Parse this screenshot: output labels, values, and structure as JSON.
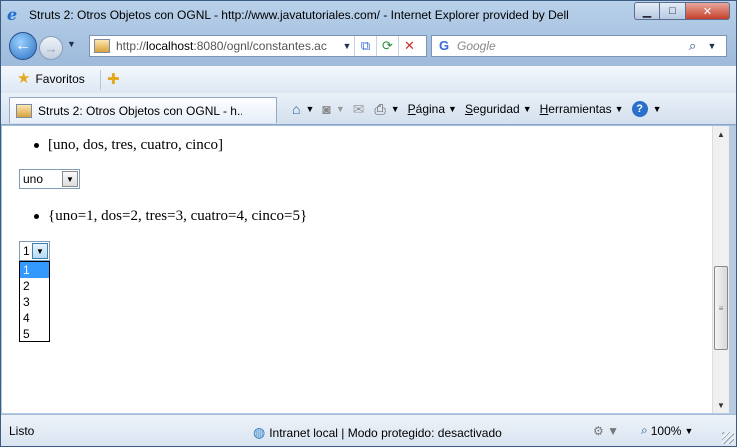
{
  "window": {
    "title": "Struts 2: Otros Objetos con OGNL - http://www.javatutoriales.com/ - Internet Explorer provided by Dell",
    "minimize": "▁",
    "maximize": "□",
    "close": "✕"
  },
  "nav": {
    "url_host": "http://",
    "url_bold": "localhost",
    "url_rest": ":8080/ognl/constantes.ac",
    "search_placeholder": "Google"
  },
  "favorites": {
    "label": "Favoritos"
  },
  "tab": {
    "label": "Struts 2: Otros Objetos con OGNL - h..."
  },
  "commandbar": {
    "page": "Página",
    "page_underline": "P",
    "page_rest": "ágina",
    "safety_underline": "S",
    "safety_rest": "eguridad",
    "tools_underline": "H",
    "tools_rest": "erramientas"
  },
  "content": {
    "list1": "[uno, dos, tres, cuatro, cinco]",
    "select1_value": "uno",
    "list2": "{uno=1, dos=2, tres=3, cuatro=4, cinco=5}",
    "select2_value": "1",
    "select2_options": [
      "1",
      "2",
      "3",
      "4",
      "5"
    ]
  },
  "status": {
    "left": "Listo",
    "zone": "Intranet local | Modo protegido: desactivado",
    "zoom": "100%"
  }
}
